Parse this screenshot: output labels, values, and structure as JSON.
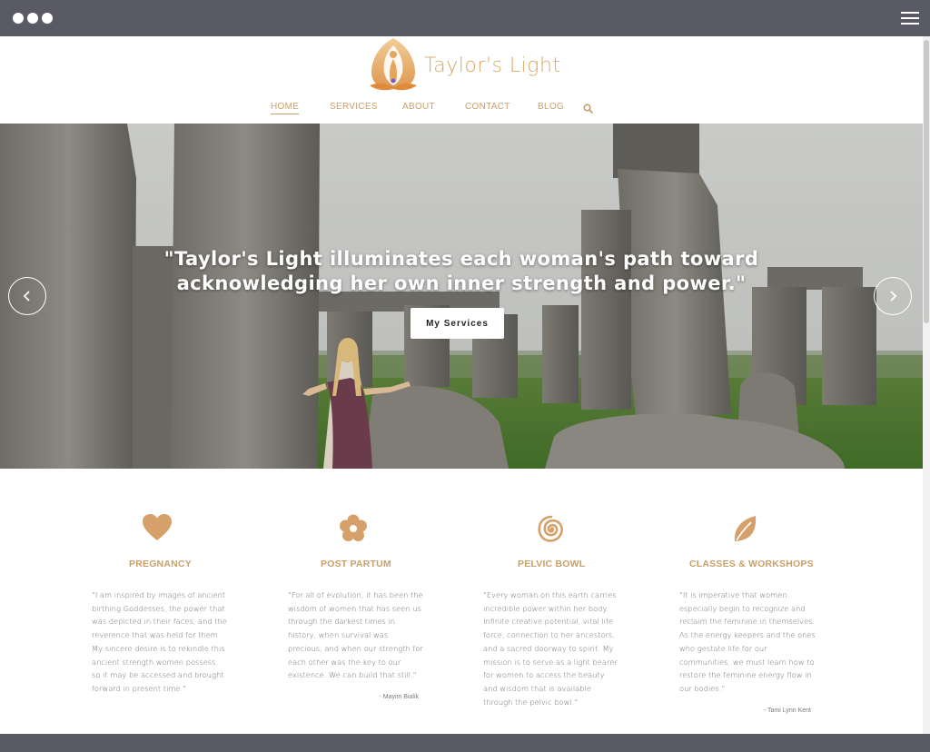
{
  "brand": {
    "name": "Taylor's Light",
    "accent": "#c99f69",
    "logo_color": "#d9a866"
  },
  "nav": {
    "items": [
      {
        "label": "HOME",
        "active": true
      },
      {
        "label": "SERVICES",
        "active": false
      },
      {
        "label": "ABOUT",
        "active": false
      },
      {
        "label": "CONTACT",
        "active": false
      },
      {
        "label": "BLOG",
        "active": false
      }
    ],
    "search_icon": "search-icon"
  },
  "hero": {
    "quote_line1": "\"Taylor's Light illuminates each woman's path toward",
    "quote_line2": "acknowledging her own inner strength and power.\"",
    "button_label": "My Services",
    "prev_icon": "chevron-left-icon",
    "next_icon": "chevron-right-icon"
  },
  "features": [
    {
      "icon": "heart-icon",
      "title": "PREGNANCY",
      "text": "\"I am inspired by images of ancient birthing Goddesses, the power that was depicted in their faces, and the reverence that was held for them. My sincere desire is to rekindle this ancient strength women possess, so it may be accessed and brought forward in present time.\"",
      "attribution": ""
    },
    {
      "icon": "flower-icon",
      "title": "POST PARTUM",
      "text": "\"For all of evolution, it has been the wisdom of women that has seen us through the darkest times in history, when survival was precious, and when our strength for each other was the key to our existence. We can build that still.\"",
      "attribution": "- Mayim Bialik"
    },
    {
      "icon": "spiral-icon",
      "title": "PELVIC BOWL",
      "text": "\"Every woman on this earth carries incredible power within her body. Infinite creative potential, vital life force, connection to her ancestors, and a sacred doorway to spirit. My mission is to serve as a light bearer for women to access the beauty and wisdom that is available through the pelvic bowl.\"",
      "attribution": ""
    },
    {
      "icon": "leaf-icon",
      "title": "CLASSES & WORKSHOPS",
      "text": "\"It is imperative that women especially begin to recognize and reclaim the feminine in themselves. As the energy keepers and the ones who gestate life for our communities, we must learn how to restore the feminine energy flow in our bodies.\"",
      "attribution": "- Tami Lynn Kent"
    }
  ]
}
